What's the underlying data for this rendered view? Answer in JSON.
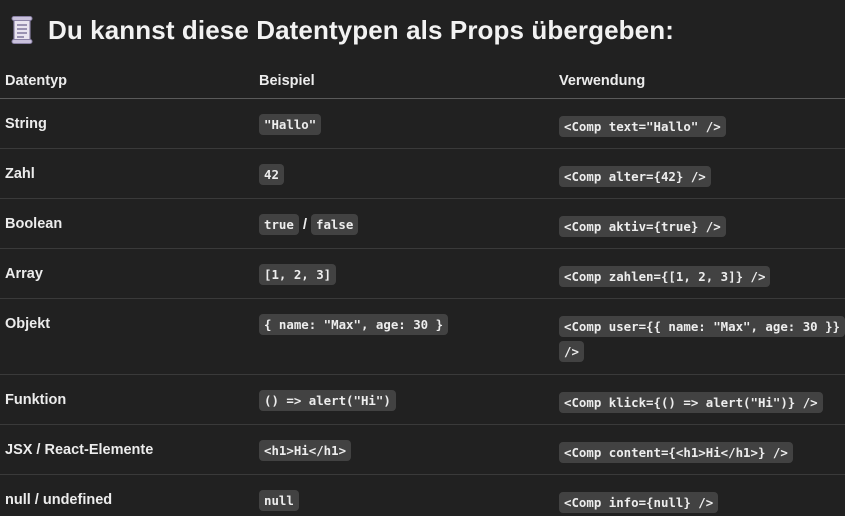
{
  "heading": {
    "icon": "scroll-icon",
    "text": "Du kannst diese Datentypen als Props übergeben:"
  },
  "table": {
    "columns": [
      "Datentyp",
      "Beispiel",
      "Verwendung"
    ],
    "rows": [
      {
        "type": "String",
        "example": "\"Hallo\"",
        "usage": "<Comp text=\"Hallo\" />"
      },
      {
        "type": "Zahl",
        "example": "42",
        "usage": "<Comp alter={42} />"
      },
      {
        "type": "Boolean",
        "example_true": "true",
        "separator": "/",
        "example_false": "false",
        "usage": "<Comp aktiv={true} />"
      },
      {
        "type": "Array",
        "example": "[1, 2, 3]",
        "usage": "<Comp zahlen={[1, 2, 3]} />"
      },
      {
        "type": "Objekt",
        "example": "{ name: \"Max\", age: 30 }",
        "usage": "<Comp user={{ name: \"Max\", age: 30 }} />"
      },
      {
        "type": "Funktion",
        "example": "() => alert(\"Hi\")",
        "usage": "<Comp klick={() => alert(\"Hi\")} />"
      },
      {
        "type": "JSX / React-Elemente",
        "example": "<h1>Hi</h1>",
        "usage": "<Comp content={<h1>Hi</h1>} />"
      },
      {
        "type": "null / undefined",
        "example": "null",
        "usage": "<Comp info={null} />"
      }
    ]
  }
}
